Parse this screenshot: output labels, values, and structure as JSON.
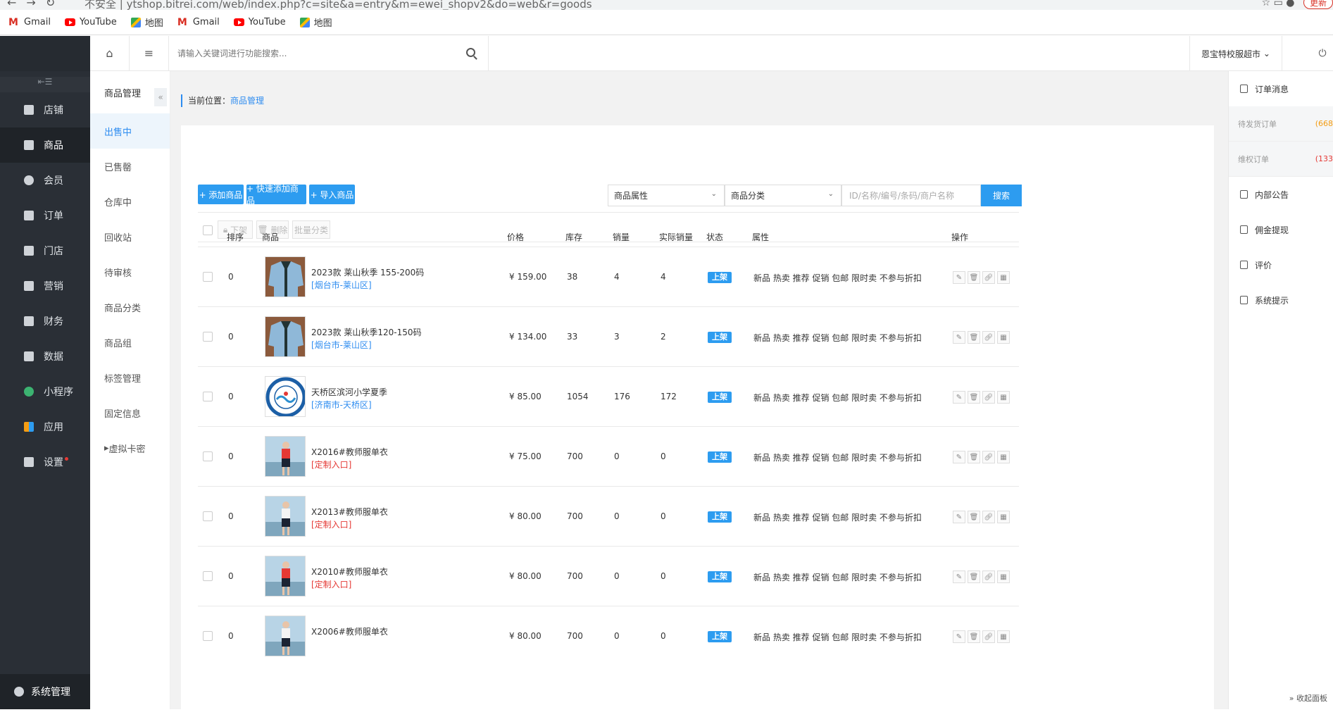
{
  "browser": {
    "url": "不安全 | ytshop.bitrei.com/web/index.php?c=site&a=entry&m=ewei_shopv2&do=web&r=goods",
    "update_label": "更新",
    "bookmarks": [
      {
        "label": "Gmail",
        "icon": "gmail-icon"
      },
      {
        "label": "YouTube",
        "icon": "youtube-icon"
      },
      {
        "label": "地图",
        "icon": "maps-icon"
      },
      {
        "label": "Gmail",
        "icon": "gmail-icon"
      },
      {
        "label": "YouTube",
        "icon": "youtube-icon"
      },
      {
        "label": "地图",
        "icon": "maps-icon"
      }
    ]
  },
  "sidebar": {
    "items": [
      {
        "label": "店铺",
        "icon": "store-icon"
      },
      {
        "label": "商品",
        "icon": "goods-icon"
      },
      {
        "label": "会员",
        "icon": "user-icon"
      },
      {
        "label": "订单",
        "icon": "order-icon"
      },
      {
        "label": "门店",
        "icon": "shop-icon"
      },
      {
        "label": "营销",
        "icon": "gift-icon"
      },
      {
        "label": "财务",
        "icon": "money-bag-icon"
      },
      {
        "label": "数据",
        "icon": "chart-icon"
      },
      {
        "label": "小程序",
        "icon": "miniapp-icon"
      },
      {
        "label": "应用",
        "icon": "apps-icon"
      },
      {
        "label": "设置",
        "icon": "gear-icon"
      }
    ],
    "bottom_label": "系统管理"
  },
  "submenu": {
    "title": "商品管理",
    "items": [
      "出售中",
      "已售罄",
      "仓库中",
      "回收站",
      "待审核",
      "商品分类",
      "商品组",
      "标签管理",
      "固定信息",
      "虚拟卡密"
    ]
  },
  "topbar": {
    "search_placeholder": "请输入关键词进行功能搜索...",
    "store_name": "恩宝特校服超市"
  },
  "breadcrumb": {
    "prefix": "当前位置：",
    "current": "商品管理"
  },
  "toolbar": {
    "add_label": "+ 添加商品",
    "quick_add_label": "+ 快速添加商品",
    "import_label": "+ 导入商品",
    "attr_select": "商品属性",
    "category_select": "商品分类",
    "keyword_placeholder": "ID/名称/编号/条码/商户名称",
    "search_label": "搜索",
    "bulk_down": "下架",
    "bulk_delete": "删除",
    "bulk_category": "批量分类"
  },
  "table": {
    "headers": [
      "排序",
      "商品",
      "价格",
      "库存",
      "销量",
      "实际销量",
      "状态",
      "属性",
      "操作"
    ],
    "rows": [
      {
        "sort": "0",
        "name": "2023款 莱山秋季 155-200码",
        "tag": "[烟台市-莱山区]",
        "tag_red": false,
        "price": "¥ 159.00",
        "stock": "38",
        "sales": "4",
        "real_sales": "4",
        "status": "上架",
        "attrs": "新品 热卖 推荐 促销 包邮 限时卖 不参与折扣",
        "img": "jacket"
      },
      {
        "sort": "0",
        "name": "2023款 莱山秋季120-150码",
        "tag": "[烟台市-莱山区]",
        "tag_red": false,
        "price": "¥ 134.00",
        "stock": "33",
        "sales": "3",
        "real_sales": "2",
        "status": "上架",
        "attrs": "新品 热卖 推荐 促销 包邮 限时卖 不参与折扣",
        "img": "jacket"
      },
      {
        "sort": "0",
        "name": "天桥区滨河小学夏季",
        "tag": "[济南市-天桥区]",
        "tag_red": false,
        "price": "¥ 85.00",
        "stock": "1054",
        "sales": "176",
        "real_sales": "172",
        "status": "上架",
        "attrs": "新品 热卖 推荐 促销 包邮 限时卖 不参与折扣",
        "img": "logo"
      },
      {
        "sort": "0",
        "name": "X2016#教师服单衣",
        "tag": "[定制入口]",
        "tag_red": true,
        "price": "¥ 75.00",
        "stock": "700",
        "sales": "0",
        "real_sales": "0",
        "status": "上架",
        "attrs": "新品 热卖 推荐 促销 包邮 限时卖 不参与折扣",
        "img": "person-red"
      },
      {
        "sort": "0",
        "name": "X2013#教师服单衣",
        "tag": "[定制入口]",
        "tag_red": true,
        "price": "¥ 80.00",
        "stock": "700",
        "sales": "0",
        "real_sales": "0",
        "status": "上架",
        "attrs": "新品 热卖 推荐 促销 包邮 限时卖 不参与折扣",
        "img": "person-white"
      },
      {
        "sort": "0",
        "name": "X2010#教师服单衣",
        "tag": "[定制入口]",
        "tag_red": true,
        "price": "¥ 80.00",
        "stock": "700",
        "sales": "0",
        "real_sales": "0",
        "status": "上架",
        "attrs": "新品 热卖 推荐 促销 包邮 限时卖 不参与折扣",
        "img": "person-red"
      },
      {
        "sort": "0",
        "name": "X2006#教师服单衣",
        "tag": "",
        "tag_red": false,
        "price": "¥ 80.00",
        "stock": "700",
        "sales": "0",
        "real_sales": "0",
        "status": "上架",
        "attrs": "新品 热卖 推荐 促销 包邮 限时卖 不参与折扣",
        "img": "person-white"
      }
    ]
  },
  "right_panel": {
    "order_msg": "订单消息",
    "stats": [
      {
        "label": "待发货订单",
        "value": "(668",
        "color": "#f39c12"
      },
      {
        "label": "维权订单",
        "value": "(133",
        "color": "#e53935"
      }
    ],
    "items": [
      "内部公告",
      "佣金提现",
      "评价",
      "系统提示"
    ],
    "collapse_label": "» 收起面板"
  }
}
